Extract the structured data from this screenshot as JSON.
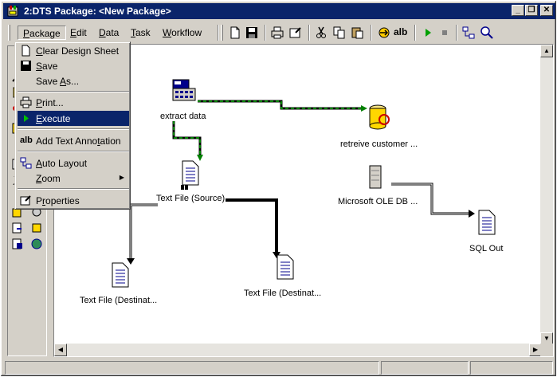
{
  "window": {
    "title": "2:DTS Package: <New Package>",
    "minimize_glyph": "_",
    "restore_glyph": "❐",
    "close_glyph": "✕"
  },
  "menubar": {
    "items": [
      {
        "label": "Package",
        "underline": "P",
        "rest": "ackage"
      },
      {
        "label": "Edit",
        "underline": "E",
        "rest": "dit"
      },
      {
        "label": "Data",
        "underline": "D",
        "rest": "ata"
      },
      {
        "label": "Task",
        "underline": "T",
        "rest": "ask"
      },
      {
        "label": "Workflow",
        "underline": "W",
        "rest": "orkflow"
      }
    ]
  },
  "toolbar": {
    "icons": [
      "new-icon",
      "save-icon",
      "print-icon",
      "properties-icon",
      "cut-icon",
      "copy-icon",
      "paste-icon",
      "import-icon",
      "text-annotation-icon",
      "execute-icon",
      "stop-icon",
      "auto-layout-icon",
      "zoom-icon"
    ],
    "annotation_label": "alb"
  },
  "package_menu": {
    "items": [
      {
        "pre": "",
        "underline": "C",
        "post": "lear Design Sheet",
        "icon": "new-sheet-icon"
      },
      {
        "pre": "",
        "underline": "S",
        "post": "ave",
        "icon": "save-icon"
      },
      {
        "pre": "Save ",
        "underline": "A",
        "post": "s...",
        "icon": ""
      },
      {
        "pre": "",
        "underline": "P",
        "post": "rint...",
        "icon": "print-icon"
      },
      {
        "pre": "",
        "underline": "E",
        "post": "xecute",
        "icon": "execute-icon"
      },
      {
        "pre": "Add Text Anno",
        "underline": "t",
        "post": "ation",
        "icon": "text-annotation-icon"
      },
      {
        "pre": "",
        "underline": "A",
        "post": "uto Layout",
        "icon": "auto-layout-icon"
      },
      {
        "pre": "",
        "underline": "Z",
        "post": "oom",
        "icon": ""
      },
      {
        "pre": "P",
        "underline": "r",
        "post": "operties",
        "icon": "properties-icon"
      }
    ],
    "annotation_icon_text": "alb",
    "submenu_arrow": "▶"
  },
  "canvas": {
    "nodes": [
      {
        "label": "extract data",
        "icon": "sql-connection-icon"
      },
      {
        "label": "retreive customer ...",
        "icon": "data-driven-query-icon"
      },
      {
        "label": "Text File (Source)",
        "icon": "text-file-icon"
      },
      {
        "label": "Microsoft OLE DB ...",
        "icon": "ole-db-server-icon"
      },
      {
        "label": "SQL Out",
        "icon": "text-file-icon"
      },
      {
        "label": "Text File (Destinat...",
        "icon": "text-file-icon"
      },
      {
        "label": "Text File (Destinat...",
        "icon": "text-file-icon"
      }
    ]
  },
  "scrollbar": {
    "up": "▲",
    "down": "▼",
    "left": "◀",
    "right": "▶"
  }
}
